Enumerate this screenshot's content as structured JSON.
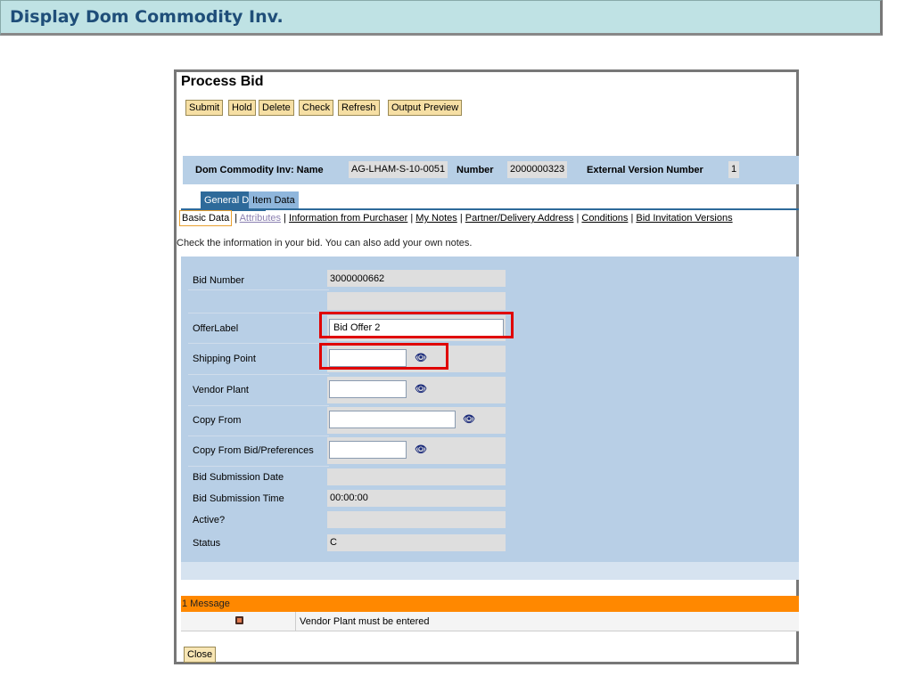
{
  "header": {
    "title": "Display Dom Commodity Inv."
  },
  "window": {
    "title": "Process Bid",
    "toolbar": [
      "Submit",
      "Hold",
      "Delete",
      "Check",
      "Refresh",
      "Output Preview"
    ],
    "info": {
      "name_label": "Dom Commodity Inv: Name",
      "name_value": "AG-LHAM-S-10-0051",
      "number_label": "Number",
      "number_value": "2000000323",
      "ext_label": "External Version Number",
      "ext_value": "1"
    },
    "tabs": [
      "General Data",
      "Item Data"
    ],
    "subnav": [
      "Basic Data",
      "Attributes",
      "Information from Purchaser",
      "My Notes",
      "Partner/Delivery Address",
      "Conditions",
      "Bid Invitation Versions"
    ],
    "hint": "Check the information in your bid. You can also add your own notes.",
    "form": {
      "bid_number_label": "Bid Number",
      "bid_number": "3000000662",
      "offer_label_label": "OfferLabel",
      "offer_label": "Bid Offer 2",
      "shipping_point_label": "Shipping Point",
      "vendor_plant_label": "Vendor Plant",
      "copy_from_label": "Copy From",
      "copy_from_bid_label": "Copy From Bid/Preferences",
      "sub_date_label": "Bid Submission Date",
      "sub_time_label": "Bid Submission Time",
      "sub_time": "00:00:00",
      "active_label": "Active?",
      "status_label": "Status",
      "status": "C"
    },
    "messages": {
      "header": "1 Message",
      "items": [
        {
          "text": "Vendor Plant must be entered",
          "icon": "error-square-icon"
        }
      ]
    },
    "close": "Close"
  }
}
